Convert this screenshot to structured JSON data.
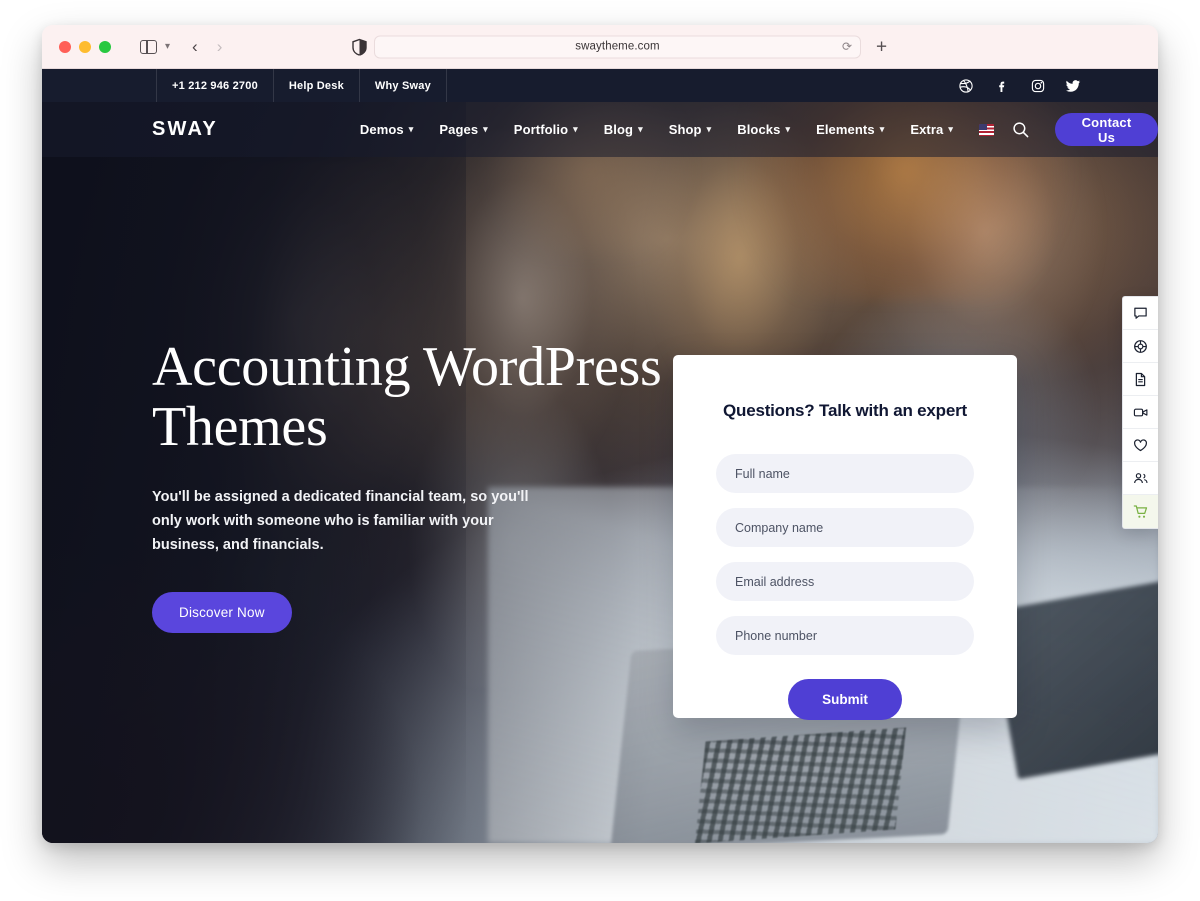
{
  "browser": {
    "traffic_lights": [
      "close",
      "minimize",
      "zoom"
    ],
    "sidebar_toggle_icon": "sidebar-icon",
    "tab_overview_icon": "chevron-down-icon",
    "back_icon": "chevron-left-icon",
    "forward_icon": "chevron-right-icon",
    "shield_icon": "privacy-shield-icon",
    "url": "swaytheme.com",
    "reload_icon": "reload-icon",
    "new_tab_label": "+"
  },
  "site": {
    "topbar": {
      "links": [
        {
          "label": "+1 212 946 2700",
          "name": "phone"
        },
        {
          "label": "Help Desk",
          "name": "help-desk"
        },
        {
          "label": "Why Sway",
          "name": "why-sway"
        }
      ],
      "social": [
        {
          "name": "dribbble-icon",
          "glyph": "dribbble"
        },
        {
          "name": "facebook-icon",
          "glyph": "facebook"
        },
        {
          "name": "instagram-icon",
          "glyph": "instagram"
        },
        {
          "name": "twitter-icon",
          "glyph": "twitter"
        }
      ]
    },
    "nav": {
      "logo": "SWAY",
      "menu": [
        {
          "label": "Demos",
          "caret": "⌄"
        },
        {
          "label": "Pages",
          "caret": "⌄"
        },
        {
          "label": "Portfolio",
          "caret": "⌄"
        },
        {
          "label": "Blog",
          "caret": "⌄"
        },
        {
          "label": "Shop",
          "caret": "⌄"
        },
        {
          "label": "Blocks",
          "caret": "⌄"
        },
        {
          "label": "Elements",
          "caret": "⌄"
        },
        {
          "label": "Extra",
          "caret": "⌄"
        }
      ],
      "language_flag": "us-flag-icon",
      "search_icon": "search-icon",
      "cta_label": "Contact Us"
    },
    "hero": {
      "title_line1": "Accounting WordPress",
      "title_line2": "Themes",
      "subtitle": "You'll be assigned a dedicated financial team, so you'll only work with someone who is familiar with your business, and financials.",
      "button_label": "Discover Now"
    },
    "lead_form": {
      "title": "Questions? Talk with an expert",
      "fields": [
        {
          "name": "full-name",
          "placeholder": "Full name",
          "value": ""
        },
        {
          "name": "company-name",
          "placeholder": "Company name",
          "value": ""
        },
        {
          "name": "email-address",
          "placeholder": "Email address",
          "value": ""
        },
        {
          "name": "phone-number",
          "placeholder": "Phone number",
          "value": ""
        }
      ],
      "submit_label": "Submit"
    },
    "right_rail": [
      {
        "name": "chat-bubble-icon",
        "active": false
      },
      {
        "name": "lifebuoy-icon",
        "active": false
      },
      {
        "name": "document-icon",
        "active": false
      },
      {
        "name": "video-camera-icon",
        "active": false
      },
      {
        "name": "heart-icon",
        "active": false
      },
      {
        "name": "people-icon",
        "active": false
      },
      {
        "name": "shopping-cart-icon",
        "active": true
      }
    ]
  },
  "colors": {
    "brand_purple": "#4f3fd4",
    "hero_button_purple": "#5a46dd",
    "topbar_navy": "#171c2e",
    "cart_green": "#79b143",
    "field_gray": "#f1f2f8",
    "page_background": "#ffffff"
  }
}
